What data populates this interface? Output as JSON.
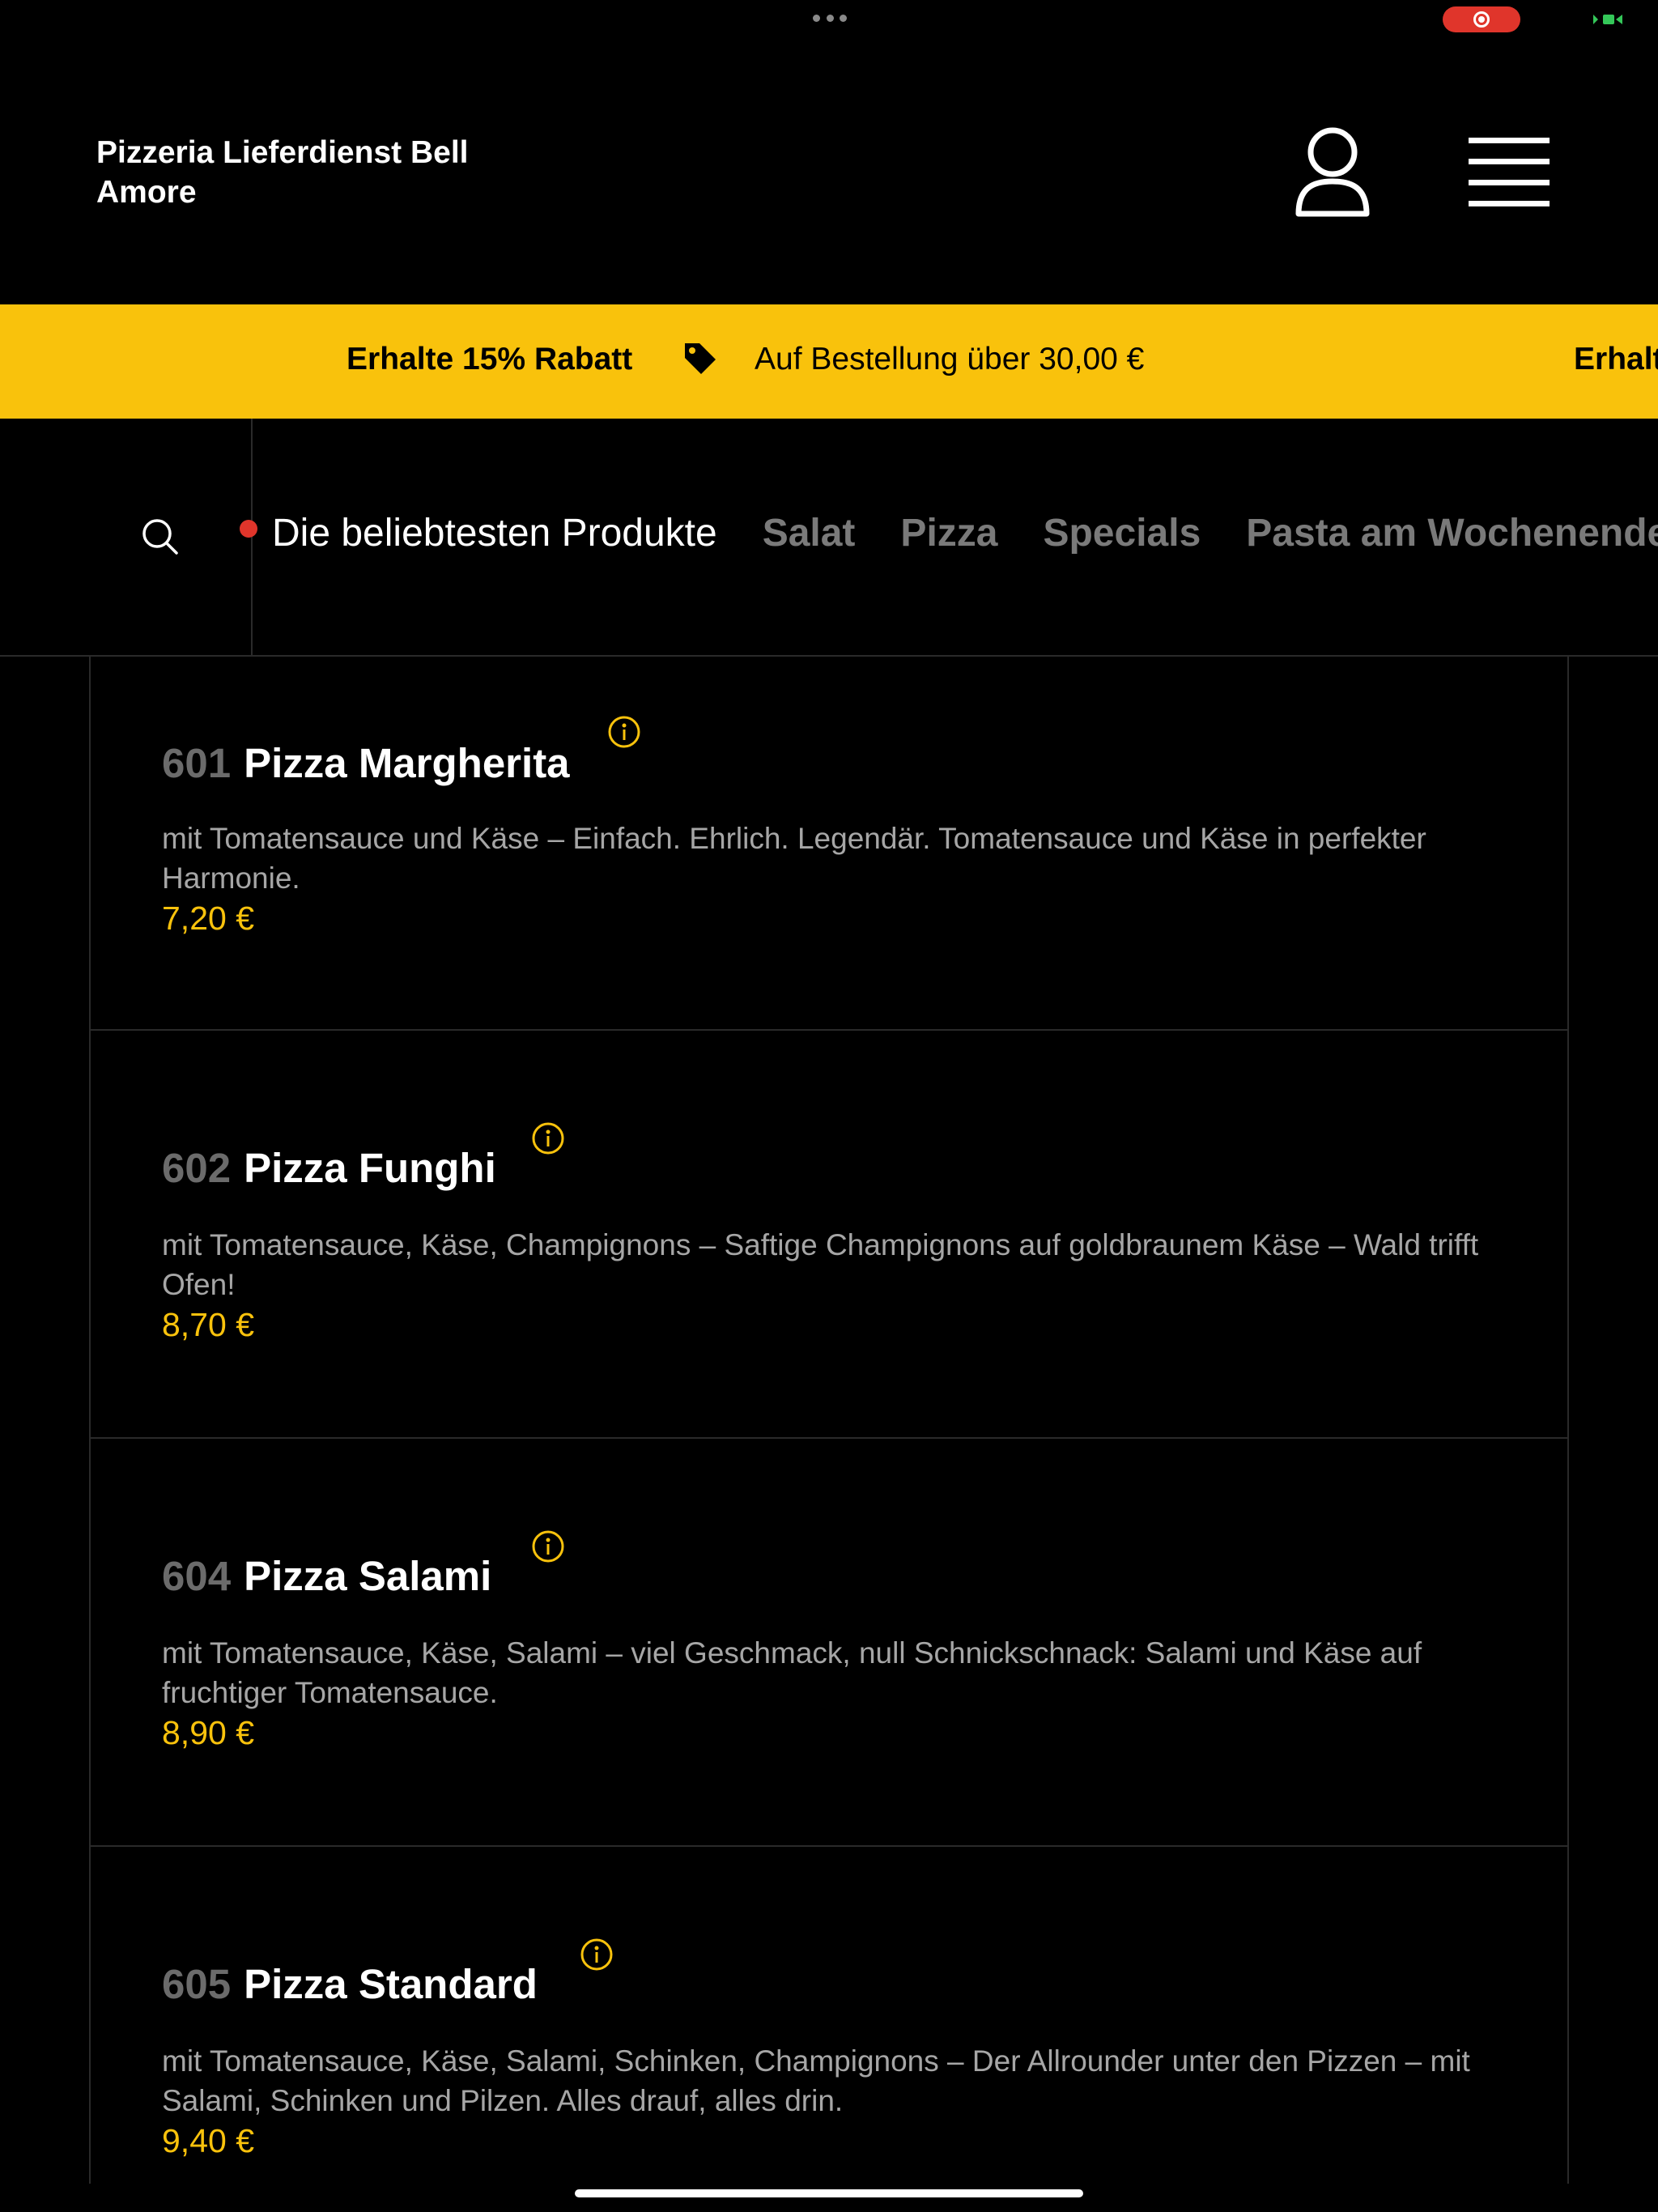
{
  "header": {
    "brand": "Pizzeria Lieferdienst Bell Amore",
    "user_icon": "user-icon",
    "menu_icon": "hamburger-menu-icon"
  },
  "promo": {
    "bold_text": "Erhalte 15% Rabatt",
    "icon": "tag-icon",
    "text": "Auf Bestellung über 30,00 €",
    "bold_text_repeat": "Erhalte"
  },
  "nav": {
    "search_icon": "search-icon",
    "tabs": [
      {
        "label": "Die beliebtesten Produkte",
        "active": true
      },
      {
        "label": "Salat",
        "active": false
      },
      {
        "label": "Pizza",
        "active": false
      },
      {
        "label": "Specials",
        "active": false
      },
      {
        "label": "Pasta am Wochenende",
        "active": false
      }
    ]
  },
  "products": [
    {
      "number": "601",
      "name": "Pizza Margherita",
      "description": "mit Tomatensauce und Käse – Einfach. Ehrlich. Legendär. Tomatensauce und Käse in perfekter Harmonie.",
      "price": "7,20 €"
    },
    {
      "number": "602",
      "name": "Pizza Funghi",
      "description": "mit Tomatensauce, Käse, Champignons – Saftige Champignons auf goldbraunem Käse – Wald trifft Ofen!",
      "price": "8,70 €"
    },
    {
      "number": "604",
      "name": "Pizza Salami",
      "description": "mit Tomatensauce, Käse, Salami – viel Geschmack, null Schnickschnack: Salami und Käse auf fruchtiger Tomatensauce.",
      "price": "8,90 €"
    },
    {
      "number": "605",
      "name": "Pizza Standard",
      "description": "mit Tomatensauce, Käse, Salami, Schinken, Champignons – Der Allrounder unter den Pizzen – mit Salami, Schinken und Pilzen. Alles drauf, alles drin.",
      "price": "9,40 €"
    }
  ],
  "colors": {
    "accent": "#f9c20c",
    "background": "#000000",
    "recording": "#e0352b"
  }
}
